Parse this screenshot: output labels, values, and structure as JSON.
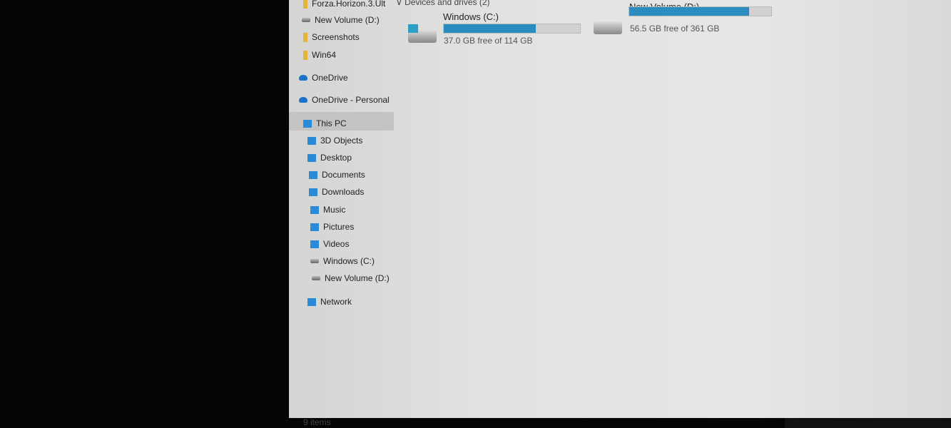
{
  "sidebar": {
    "items": [
      {
        "label": "Forza.Horizon.3.Ult",
        "icon": "folder-icon"
      },
      {
        "label": "New Volume (D:)",
        "icon": "drive-icon"
      },
      {
        "label": "Screenshots",
        "icon": "folder-icon"
      },
      {
        "label": "Win64",
        "icon": "folder-icon"
      },
      {
        "label": "OneDrive",
        "icon": "cloud-icon"
      },
      {
        "label": "OneDrive - Personal",
        "icon": "cloud-icon"
      },
      {
        "label": "This PC",
        "icon": "computer-icon",
        "selected": true
      },
      {
        "label": "3D Objects",
        "icon": "cube-icon"
      },
      {
        "label": "Desktop",
        "icon": "desktop-icon"
      },
      {
        "label": "Documents",
        "icon": "document-icon"
      },
      {
        "label": "Downloads",
        "icon": "download-icon"
      },
      {
        "label": "Music",
        "icon": "music-icon"
      },
      {
        "label": "Pictures",
        "icon": "pictures-icon"
      },
      {
        "label": "Videos",
        "icon": "videos-icon"
      },
      {
        "label": "Windows (C:)",
        "icon": "drive-icon"
      },
      {
        "label": "New Volume (D:)",
        "icon": "drive-icon"
      },
      {
        "label": "Network",
        "icon": "network-icon"
      }
    ]
  },
  "main": {
    "group_header": "Devices and drives (2)",
    "drives": [
      {
        "name": "Windows (C:)",
        "free_text": "37.0 GB free of 114 GB",
        "used_fraction": 0.675
      },
      {
        "name": "New Volume (D:)",
        "free_text": "56.5 GB free of 361 GB",
        "used_fraction": 0.843
      }
    ]
  },
  "status": {
    "items": "9 items"
  },
  "colors": {
    "bar_fill": "#2a8dbd",
    "selection": "#c3c3c1"
  }
}
